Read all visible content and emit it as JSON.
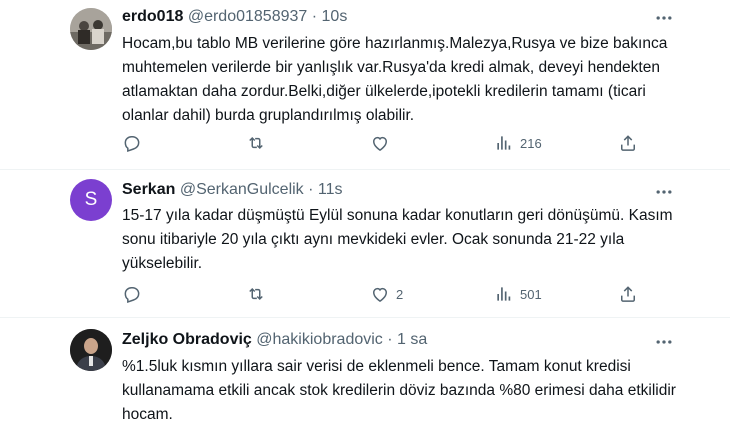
{
  "tweets": [
    {
      "name": "erdo018",
      "handle": "@erdo01858937",
      "time": "10s",
      "text": "Hocam,bu tablo MB verilerine göre hazırlanmış.Malezya,Rusya ve bize bakınca muhtemelen verilerde bir yanlışlık var.Rusya'da kredi almak, deveyi hendekten atlamaktan daha zordur.Belki,diğer ülkelerde,ipotekli kredilerin tamamı (ticari olanlar dahil) burda gruplandırılmış olabilir.",
      "replies": "",
      "retweets": "",
      "likes": "",
      "views": "216"
    },
    {
      "name": "Serkan",
      "handle": "@SerkanGulcelik",
      "time": "11s",
      "avatar_letter": "S",
      "avatar_color": "#7b3fd0",
      "text": "15-17 yıla kadar düşmüştü Eylül sonuna kadar konutların geri dönüşümü. Kasım sonu itibariyle 20 yıla çıktı aynı mevkideki evler. Ocak sonunda 21-22 yıla yükselebilir.",
      "replies": "",
      "retweets": "",
      "likes": "2",
      "views": "501"
    },
    {
      "name": "Zeljko Obradoviç",
      "handle": "@hakikiobradovic",
      "time": "1 sa",
      "text": "%1.5luk kısmın yıllara sair verisi de eklenmeli bence. Tamam konut kredisi kullanamama etkili ancak stok kredilerin döviz bazında %80 erimesi daha etkilidir hocam."
    }
  ],
  "separator": "·",
  "colors": {
    "text": "#0f1419",
    "secondary": "#536471",
    "border": "#eff3f4"
  },
  "icons": {
    "more": "more-horizontal-icon",
    "reply": "reply-icon",
    "retweet": "retweet-icon",
    "like": "heart-icon",
    "views": "views-icon",
    "share": "share-icon"
  }
}
